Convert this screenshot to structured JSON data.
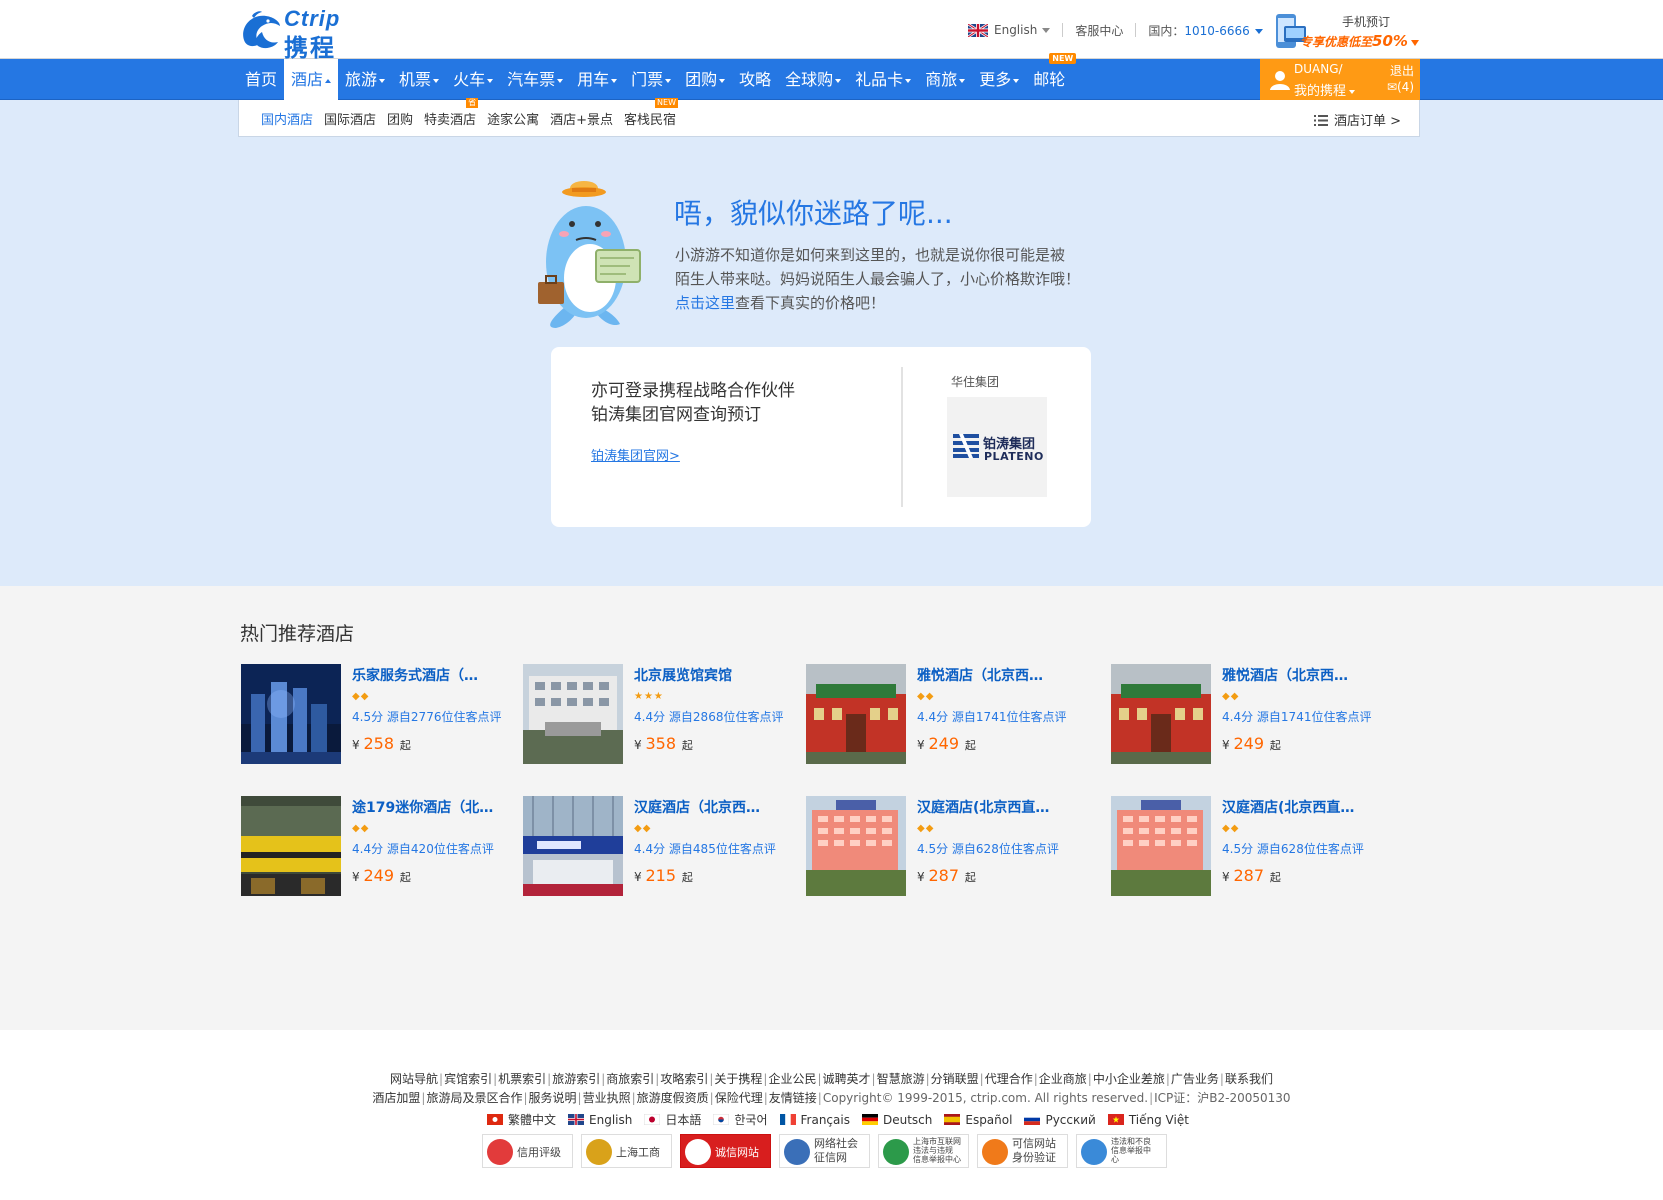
{
  "header": {
    "logo": {
      "brand_en": "Ctrip",
      "brand_cn": "携程"
    },
    "language": {
      "label": "English",
      "flag": "uk-flag-icon"
    },
    "service_center": "客服中心",
    "hotline_label": "国内：",
    "hotline_number": "1010-6666",
    "mobile_promo": {
      "line1": "手机预订",
      "line2_prefix": "专享优惠低至",
      "line2_value": "50%"
    }
  },
  "mainnav": {
    "items": [
      {
        "label": "首页",
        "dropdown": false
      },
      {
        "label": "酒店",
        "dropdown": true,
        "active": true
      },
      {
        "label": "旅游",
        "dropdown": true
      },
      {
        "label": "机票",
        "dropdown": true
      },
      {
        "label": "火车",
        "dropdown": true
      },
      {
        "label": "汽车票",
        "dropdown": true
      },
      {
        "label": "用车",
        "dropdown": true
      },
      {
        "label": "门票",
        "dropdown": true
      },
      {
        "label": "团购",
        "dropdown": true
      },
      {
        "label": "攻略",
        "dropdown": false
      },
      {
        "label": "全球购",
        "dropdown": true
      },
      {
        "label": "礼品卡",
        "dropdown": true
      },
      {
        "label": "商旅",
        "dropdown": true
      },
      {
        "label": "更多",
        "dropdown": true
      },
      {
        "label": "邮轮",
        "dropdown": false,
        "badge": "NEW"
      }
    ],
    "user": {
      "name": "DUANG/",
      "my_ctrip": "我的携程",
      "logout": "退出",
      "messages": "(4)"
    }
  },
  "subnav": {
    "items": [
      {
        "label": "国内酒店",
        "active": true
      },
      {
        "label": "国际酒店"
      },
      {
        "label": "团购"
      },
      {
        "label": "特卖酒店",
        "badge": "省"
      },
      {
        "label": "途家公寓"
      },
      {
        "label": "酒店+景点"
      },
      {
        "label": "客栈民宿",
        "badge": "NEW"
      }
    ],
    "orders_label": "酒店订单 >"
  },
  "lost": {
    "title": "唔，貌似你迷路了呢...",
    "desc_line1": "小游游不知道你是如何来到这里的，也就是说你很可能是被",
    "desc_line2": "陌生人带来哒。妈妈说陌生人最会骗人了，小心价格欺诈哦！",
    "desc_link": "点击这里",
    "desc_tail": "查看下真实的价格吧！"
  },
  "partner": {
    "line1": "亦可登录携程战略合作伙伴",
    "line2": "铂涛集团官网查询预订",
    "link": "铂涛集团官网>",
    "group_label": "华住集团",
    "logo_cn": "铂涛集团",
    "logo_en": "PLATENO"
  },
  "hot": {
    "title": "热门推荐酒店",
    "hotels": [
      {
        "name": "乐家服务式酒店（…",
        "stars": "◆◆",
        "score": "4.5分",
        "reviews": "源自2776位住客点评",
        "currency": "¥",
        "price": "258",
        "suffix": "起",
        "theme": "night-tower"
      },
      {
        "name": "北京展览馆宾馆",
        "stars": "★★★",
        "score": "4.4分",
        "reviews": "源自2868位住客点评",
        "currency": "¥",
        "price": "358",
        "suffix": "起",
        "theme": "building-white"
      },
      {
        "name": "雅悦酒店（北京西…",
        "stars": "◆◆",
        "score": "4.4分",
        "reviews": "源自1741位住客点评",
        "currency": "¥",
        "price": "249",
        "suffix": "起",
        "theme": "red-gate"
      },
      {
        "name": "雅悦酒店（北京西…",
        "stars": "◆◆",
        "score": "4.4分",
        "reviews": "源自1741位住客点评",
        "currency": "¥",
        "price": "249",
        "suffix": "起",
        "theme": "red-gate"
      },
      {
        "name": "途179迷你酒店（北…",
        "stars": "◆◆",
        "score": "4.4分",
        "reviews": "源自420位住客点评",
        "currency": "¥",
        "price": "249",
        "suffix": "起",
        "theme": "yellow-shops"
      },
      {
        "name": "汉庭酒店（北京西…",
        "stars": "◆◆",
        "score": "4.4分",
        "reviews": "源自485位住客点评",
        "currency": "¥",
        "price": "215",
        "suffix": "起",
        "theme": "blue-front"
      },
      {
        "name": "汉庭酒店(北京西直…",
        "stars": "◆◆",
        "score": "4.5分",
        "reviews": "源自628位住客点评",
        "currency": "¥",
        "price": "287",
        "suffix": "起",
        "theme": "pink-building"
      },
      {
        "name": "汉庭酒店(北京西直…",
        "stars": "◆◆",
        "score": "4.5分",
        "reviews": "源自628位住客点评",
        "currency": "¥",
        "price": "287",
        "suffix": "起",
        "theme": "pink-building"
      }
    ]
  },
  "footer": {
    "row1": [
      "网站导航",
      "宾馆索引",
      "机票索引",
      "旅游索引",
      "商旅索引",
      "攻略索引",
      "关于携程",
      "企业公民",
      "诚聘英才",
      "智慧旅游",
      "分销联盟",
      "代理合作",
      "企业商旅",
      "中小企业差旅",
      "广告业务",
      "联系我们"
    ],
    "row2": [
      "酒店加盟",
      "旅游局及景区合作",
      "服务说明",
      "营业执照",
      "旅游度假资质",
      "保险代理",
      "友情链接"
    ],
    "copyright": "Copyright© 1999-2015, ctrip.com. All rights reserved.",
    "icp": "ICP证：沪B2-20050130",
    "languages": [
      {
        "label": "繁體中文",
        "flag": "hk-flag-icon"
      },
      {
        "label": "English",
        "flag": "uk-flag-icon"
      },
      {
        "label": "日本語",
        "flag": "jp-flag-icon"
      },
      {
        "label": "한국어",
        "flag": "kr-flag-icon"
      },
      {
        "label": "Français",
        "flag": "fr-flag-icon"
      },
      {
        "label": "Deutsch",
        "flag": "de-flag-icon"
      },
      {
        "label": "Español",
        "flag": "es-flag-icon"
      },
      {
        "label": "Русский",
        "flag": "ru-flag-icon"
      },
      {
        "label": "Tiếng Việt",
        "flag": "vn-flag-icon"
      }
    ],
    "badges": [
      {
        "label": "信用评级",
        "icon": "credit-rating-icon"
      },
      {
        "label": "上海工商",
        "icon": "shanghai-aic-icon"
      },
      {
        "label": "诚信网站",
        "icon": "integrity-site-icon"
      },
      {
        "label": "网络社会\n征信网",
        "icon": "network-credit-icon"
      },
      {
        "label": "上海市互联网\n违法与违规\n信息举报中心",
        "icon": "report-center-icon"
      },
      {
        "label": "可信网站\n身份验证",
        "icon": "trusted-site-icon"
      },
      {
        "label": "违法和不良\n信息举报中\n心",
        "icon": "illegal-report-icon"
      }
    ]
  },
  "colors": {
    "brand_blue": "#2577e3",
    "orange": "#ff9a14",
    "price": "#ff6600",
    "hero_bg": "#ddeafa"
  }
}
